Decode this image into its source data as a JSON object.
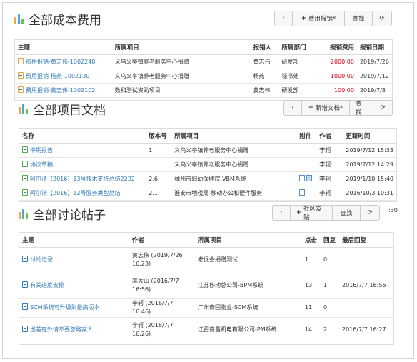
{
  "costs": {
    "title": "全部成本费用",
    "buttons": {
      "back": "‹",
      "add": "费用报销*",
      "search": "查找",
      "refresh": "⟳"
    },
    "headers": [
      "主题",
      "所属项目",
      "报销人",
      "所属部门",
      "报销费用",
      "报销日期"
    ],
    "rows": [
      {
        "subject": "费用报销-黄志伟-1002248",
        "project": "义乌义亭镇养老服务中心捐赠",
        "person": "黄志伟",
        "dept": "研发部",
        "amount": "2000.00",
        "date": "2019/7/26"
      },
      {
        "subject": "费用报销-杨燕-1002130",
        "project": "义乌义亭镇养老服务中心捐赠",
        "person": "杨燕",
        "dept": "秘书处",
        "amount": "1000.00",
        "date": "2019/7/12"
      },
      {
        "subject": "费用报销-黄志伟-1002102",
        "project": "数和测试资助项目",
        "person": "黄志伟",
        "dept": "研发部",
        "amount": "100.00",
        "date": "2019/7/8"
      }
    ]
  },
  "docs": {
    "title": "全部项目文档",
    "buttons": {
      "back": "‹",
      "add": "新增文档*",
      "search": "查找",
      "refresh": "⟳"
    },
    "headers": [
      "名称",
      "版本号",
      "所属项目",
      "附件",
      "作者",
      "更新时间"
    ],
    "rows": [
      {
        "name": "中期报告",
        "version": "1",
        "project": "义乌义亭镇养老服务中心捐赠",
        "author": "李轲",
        "time": "2019/7/12 15:33"
      },
      {
        "name": "协议草稿",
        "version": "",
        "project": "义乌义亭镇养老服务中心捐赠",
        "author": "李轲",
        "time": "2019/7/12 14:29"
      },
      {
        "name": "阿尔法【2016】13号技术支持总结2222",
        "version": "2.6",
        "project": "嵊州市妇幼保健院-VBM系统",
        "author": "李轲",
        "time": "2019/1/10 15:40"
      },
      {
        "name": "阿尔法【2016】12号服务类型总结",
        "version": "2.1",
        "project": "淮安市地税局-移动办公和硬件服务",
        "author": "李轲",
        "time": "2016/10/3 10:31"
      }
    ],
    "stray": ":30"
  },
  "posts": {
    "title": "全部讨论帖子",
    "buttons": {
      "back": "‹",
      "add": "社区发贴",
      "search": "查找",
      "refresh": "⟳"
    },
    "headers": [
      "主题",
      "作者",
      "所属项目",
      "点击",
      "回复",
      "最后回复"
    ],
    "rows": [
      {
        "subject": "讨论记录",
        "author": "黄志伟 (2019/7/26 16:23)",
        "project": "老促会捐赠测试",
        "clicks": "1",
        "replies": "0",
        "last": ""
      },
      {
        "subject": "有关进度安排",
        "author": "高大山 (2016/7/7 16:56)",
        "project": "江苏移动总公司-BPM系统",
        "clicks": "13",
        "replies": "1",
        "last": "2016/7/7 16:56"
      },
      {
        "subject": "SCM系统可升级到最高版本",
        "author": "李轲 (2016/7/7 16:46)",
        "project": "广州奇固物业-SCM系统",
        "clicks": "11",
        "replies": "0",
        "last": ""
      },
      {
        "subject": "出差在外请不要忽略家人",
        "author": "李轲 (2016/7/7 16:26)",
        "project": "江西南昌机电有限公司-PM系统",
        "clicks": "14",
        "replies": "2",
        "last": "2016/7/7 16:27"
      }
    ]
  }
}
